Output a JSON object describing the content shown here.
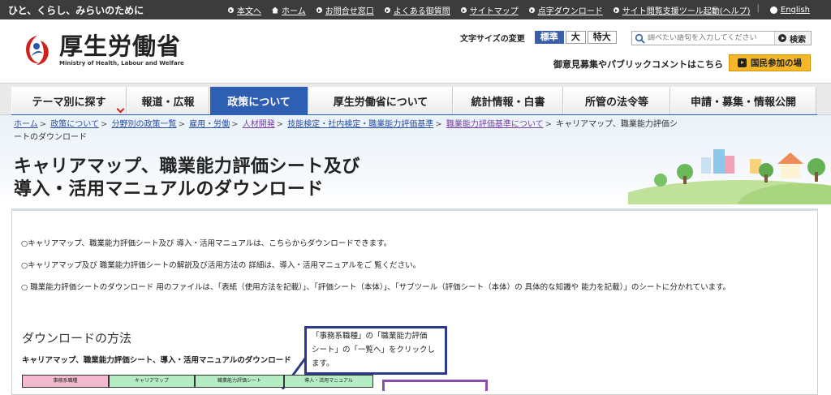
{
  "topbar": {
    "tagline": "ひと、くらし、みらいのために",
    "links": [
      {
        "label": "本文へ",
        "icon": "circle-arrow-icon"
      },
      {
        "label": "ホーム",
        "icon": "home-icon"
      },
      {
        "label": "お問合せ窓口",
        "icon": "circle-arrow-icon"
      },
      {
        "label": "よくある御質問",
        "icon": "circle-arrow-icon"
      },
      {
        "label": "サイトマップ",
        "icon": "circle-arrow-icon"
      },
      {
        "label": "点字ダウンロード",
        "icon": "circle-arrow-icon"
      },
      {
        "label": "サイト閲覧支援ツール起動(ヘルプ)",
        "icon": "circle-arrow-icon"
      }
    ],
    "english": "English"
  },
  "header": {
    "logo_ja": "厚生労働省",
    "logo_en": "Ministry of Health, Labour and Welfare",
    "font_size_label": "文字サイズの変更",
    "font_sizes": [
      "標準",
      "大",
      "特大"
    ],
    "search_placeholder": "調べたい語句を入力してください",
    "search_button": "検索",
    "public_comment": "御意見募集やパブリックコメントはこちら",
    "participation_button": "国民参加の場"
  },
  "nav": {
    "items": [
      "テーマ別に探す",
      "報道・広報",
      "政策について",
      "厚生労働省について",
      "統計情報・白書",
      "所管の法令等",
      "申請・募集・情報公開"
    ],
    "active": "政策について"
  },
  "breadcrumb": {
    "items": [
      "ホーム",
      "政策について",
      "分野別の政策一覧",
      "雇用・労働",
      "人材開発",
      "技能検定・社内検定・職業能力評価基準",
      "職業能力評価基準について"
    ],
    "current": "キャリアマップ、職業能力評価シートのダウンロード"
  },
  "page": {
    "title_line1": "キャリアマップ、職業能力評価シート及び",
    "title_line2": "導入・活用マニュアルのダウンロード",
    "intro": [
      "○キャリアマップ、職業能力評価シート及び 導入・活用マニュアルは、こちらからダウンロードできます。",
      "○キャリアマップ及び 職業能力評価シートの解説及び活用方法の 詳細は、導入・活用マニュアルをご 覧ください。",
      "○ 職業能力評価シートのダウンロード 用のファイルは、「表紙（使用方法を記載）」、「評価シート（本体）」、「サブツール（評価シート（本体）の 具体的な知識や 能力を記載）」のシートに分かれています。"
    ],
    "download_heading": "ダウンロードの方法",
    "download_sub": "キャリアマップ、職業能力評価シート、導入・活用マニュアルのダウンロード",
    "callout_lines": [
      "「事務系職種」の「職業能力評価",
      "シート」の「一覧へ」をクリックし",
      "ます。"
    ],
    "table_headers": [
      "事務系職種",
      "キャリアマップ",
      "職業能力評価シート",
      "導入・活用マニュアル"
    ]
  },
  "colors": {
    "topbar_bg": "#3c3c3c",
    "nav_active": "#2f5fb3",
    "participation_button": "#f5b72a",
    "callout_border": "#2c3a8e",
    "highlight_border": "#8a4fae"
  }
}
